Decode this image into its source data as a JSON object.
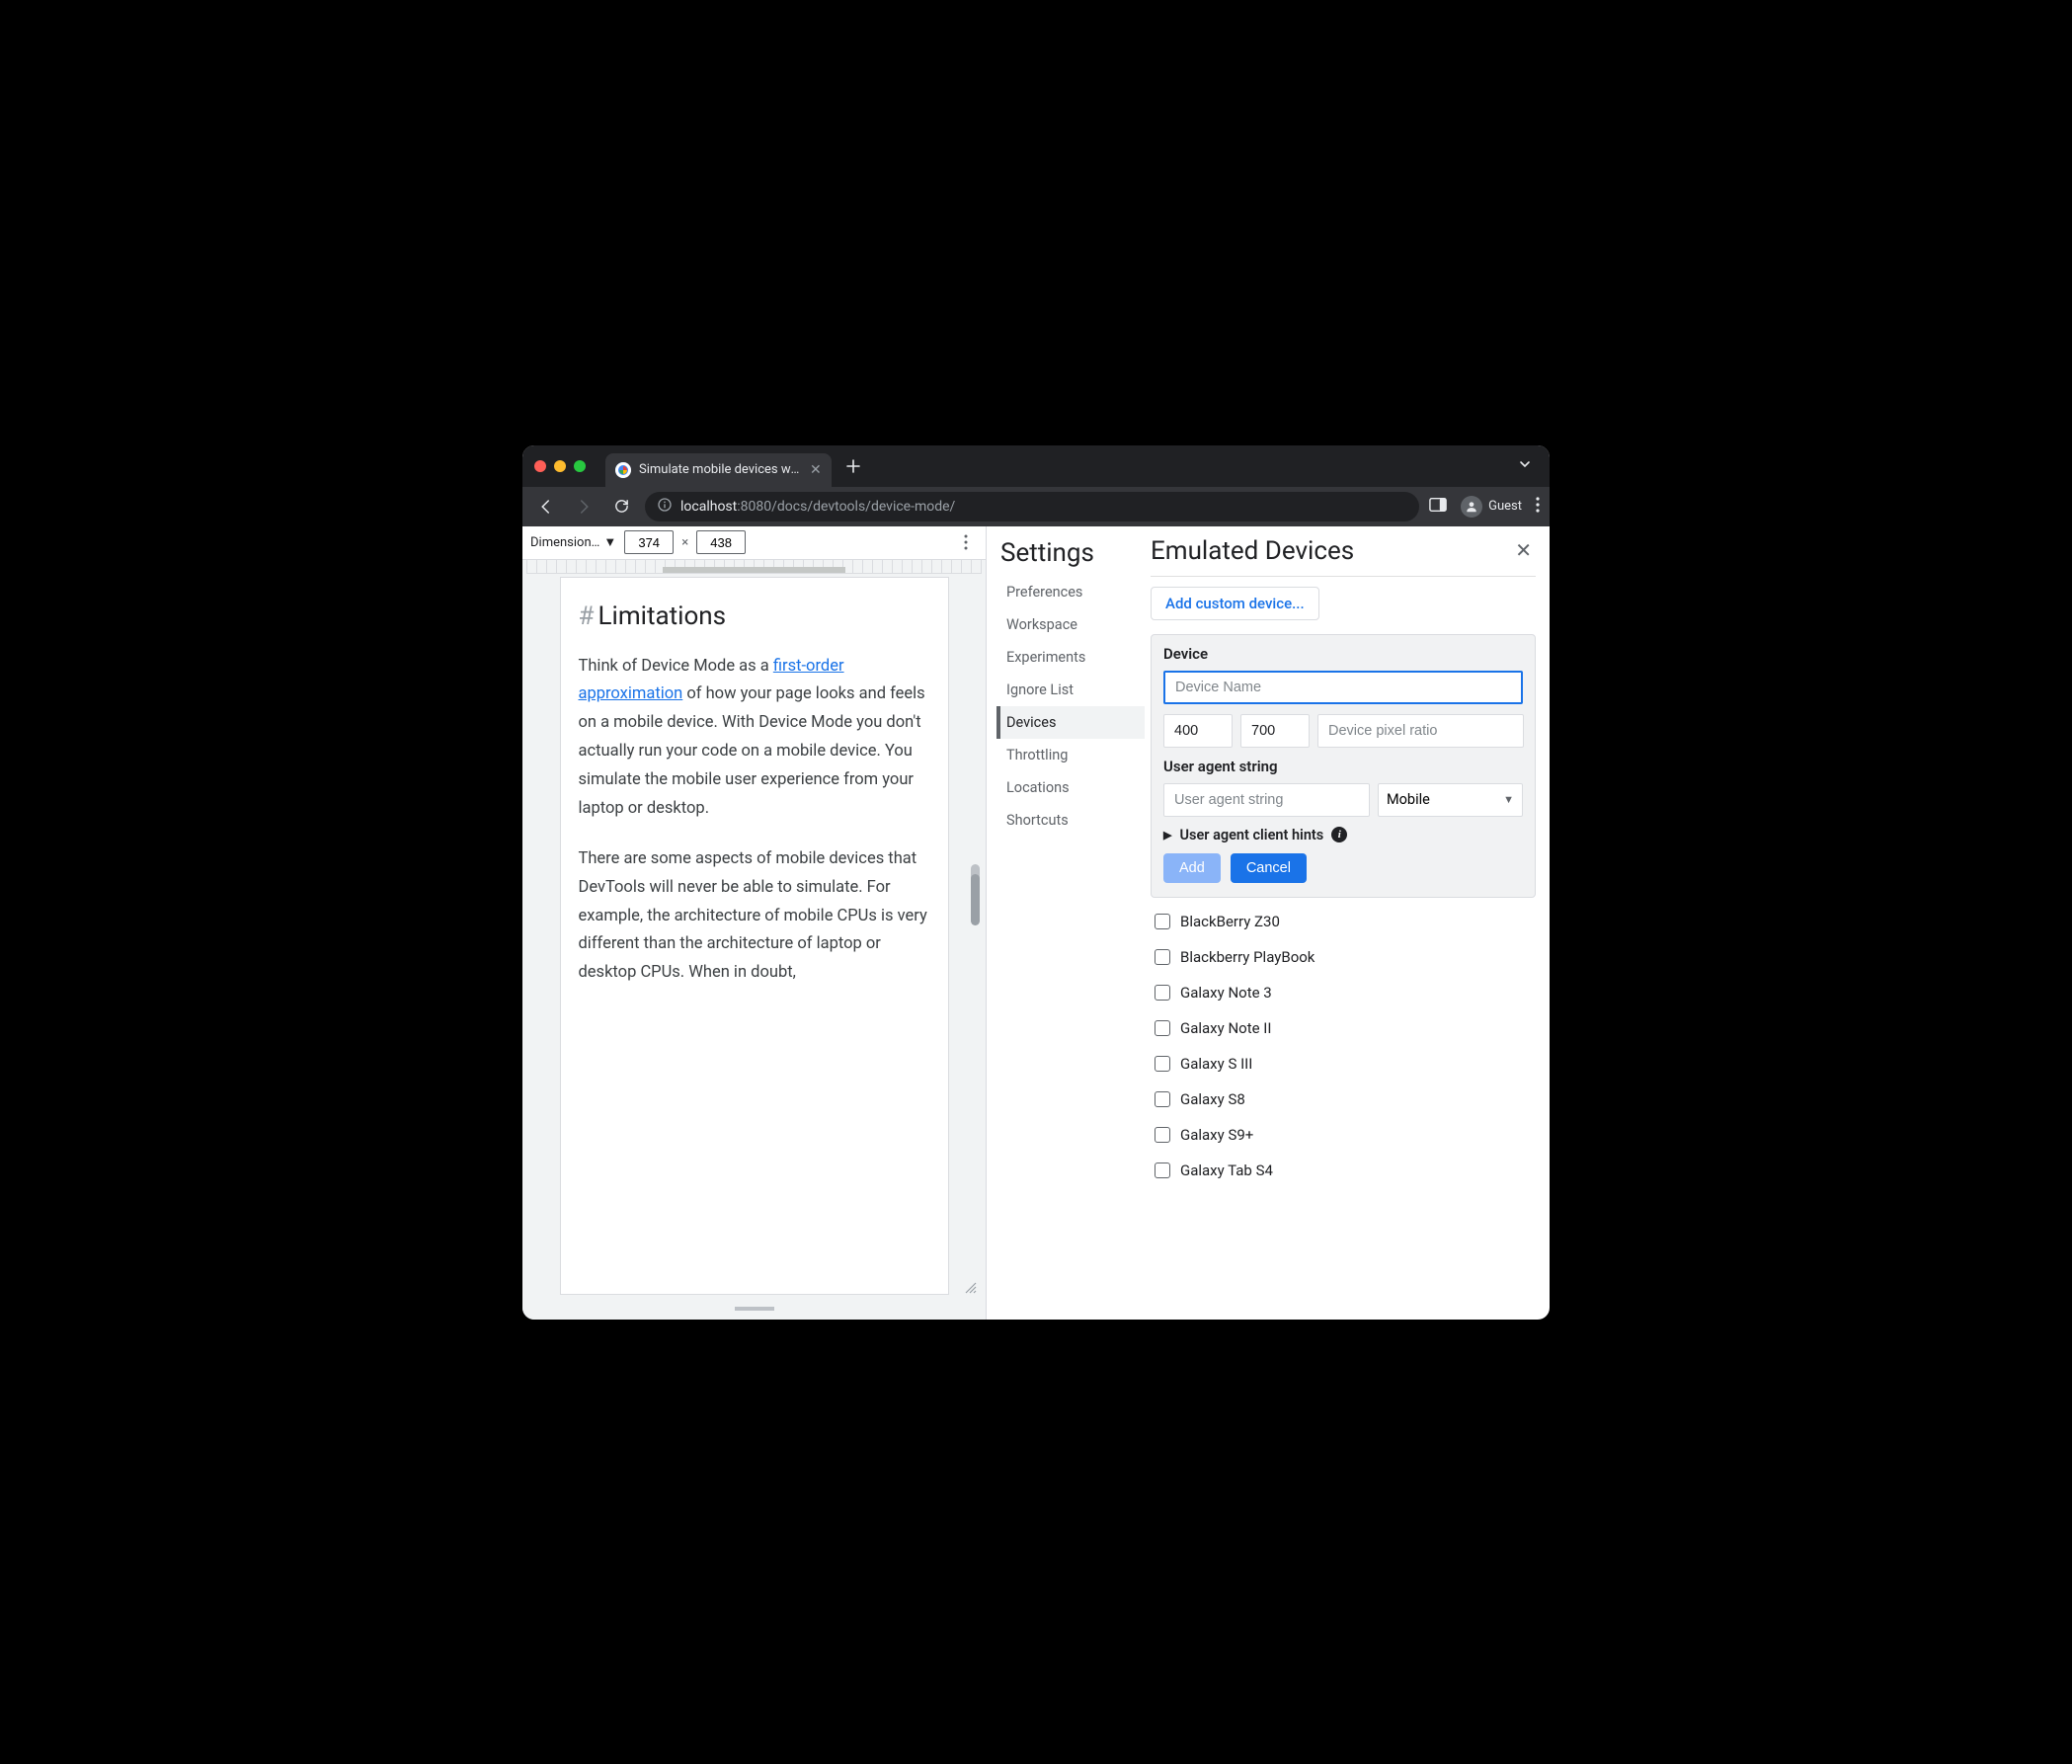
{
  "tab": {
    "title": "Simulate mobile devices with D"
  },
  "addr": {
    "host": "localhost",
    "port": ":8080",
    "path": "/docs/devtools/device-mode/",
    "guest_label": "Guest"
  },
  "device_toolbar": {
    "dimensions_label": "Dimension…",
    "width": "374",
    "height": "438"
  },
  "page": {
    "heading": "Limitations",
    "p1_pre": "Think of Device Mode as a ",
    "p1_link": "first-order approximation",
    "p1_post": " of how your page looks and feels on a mobile device. With Device Mode you don't actually run your code on a mobile device. You simulate the mobile user experience from your laptop or desktop.",
    "p2": "There are some aspects of mobile devices that DevTools will never be able to simulate. For example, the architecture of mobile CPUs is very different than the architecture of laptop or desktop CPUs. When in doubt,"
  },
  "settings": {
    "title": "Settings",
    "nav": [
      "Preferences",
      "Workspace",
      "Experiments",
      "Ignore List",
      "Devices",
      "Throttling",
      "Locations",
      "Shortcuts"
    ],
    "active_index": 4
  },
  "emulated": {
    "title": "Emulated Devices",
    "add_custom": "Add custom device...",
    "form": {
      "device_label": "Device",
      "name_placeholder": "Device Name",
      "width": "400",
      "height": "700",
      "dpr_placeholder": "Device pixel ratio",
      "ua_label": "User agent string",
      "ua_placeholder": "User agent string",
      "ua_type": "Mobile",
      "hints_label": "User agent client hints",
      "add_btn": "Add",
      "cancel_btn": "Cancel"
    },
    "devices": [
      "BlackBerry Z30",
      "Blackberry PlayBook",
      "Galaxy Note 3",
      "Galaxy Note II",
      "Galaxy S III",
      "Galaxy S8",
      "Galaxy S9+",
      "Galaxy Tab S4"
    ]
  }
}
